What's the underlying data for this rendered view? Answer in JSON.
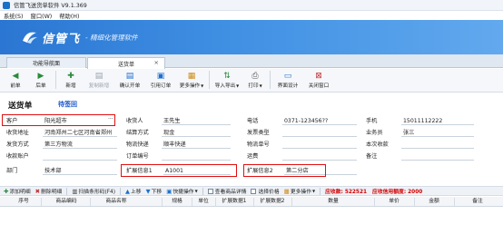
{
  "window": {
    "title": "信管飞送货单软件 V9.1.369"
  },
  "menu": [
    "系统(S)",
    "窗口(W)",
    "帮助(H)"
  ],
  "banner": {
    "brand": "信管飞",
    "slogan": "- 精细化管理软件"
  },
  "tabs": [
    {
      "label": "功能导航面"
    },
    {
      "label": "送货单",
      "close": "×"
    }
  ],
  "toolbar": {
    "items": [
      {
        "label": "前单",
        "icon": "◀"
      },
      {
        "label": "后单",
        "icon": "▶"
      },
      {
        "label": "新增",
        "icon": "✚"
      },
      {
        "label": "复制新增",
        "icon": "▤"
      },
      {
        "label": "确认开单",
        "icon": "▤"
      },
      {
        "label": "引用订单",
        "icon": "▣"
      },
      {
        "label": "更多操作",
        "icon": "▦"
      },
      {
        "label": "导入导出",
        "icon": "⇅"
      },
      {
        "label": "打印",
        "icon": "⎙"
      },
      {
        "label": "界面设计",
        "icon": "▭"
      },
      {
        "label": "关闭窗口",
        "icon": "⊠"
      }
    ]
  },
  "doc": {
    "title": "送货单",
    "status": "待签回"
  },
  "form": {
    "customer_label": "客户",
    "customer": "阳光超市",
    "receiver_label": "收货人",
    "receiver": "王先生",
    "phone_label": "电话",
    "phone": "0371-123456??",
    "mobile_label": "手机",
    "mobile": "15011112222",
    "address_label": "收货地址",
    "address": "河南郑州二七区河南省郑州",
    "settle_label": "结算方式",
    "settle": "现金",
    "invoice_label": "发票类型",
    "invoice": "",
    "salesman_label": "业务员",
    "salesman": "张三",
    "ship_label": "发货方式",
    "ship": "第三方物流",
    "logistics_label": "物流快递",
    "logistics": "顺丰快递",
    "tracking_label": "物流单号",
    "tracking": "",
    "receivable_label": "本次收款",
    "receivable": "",
    "account_label": "收款账户",
    "account": "",
    "order_label": "订单编号",
    "order": "",
    "freight_label": "运费",
    "freight": "",
    "note_label": "备注",
    "note": "",
    "dept_label": "部门",
    "dept": "技术部",
    "ext1_label": "扩展信息1",
    "ext1": "A1001",
    "ext2_label": "扩展信息2",
    "ext2": "第二分店"
  },
  "subtoolbar": {
    "items": [
      {
        "label": "添加明细",
        "icon": "✚"
      },
      {
        "label": "删除明细",
        "icon": "✖"
      },
      {
        "label": "扫描条形码(F4)",
        "icon": "▥"
      },
      {
        "label": "上移",
        "icon": "▲"
      },
      {
        "label": "下移",
        "icon": "▼"
      },
      {
        "label": "快捷操作",
        "icon": "▣"
      },
      {
        "label": "查看商品详情",
        "icon": "▤"
      },
      {
        "label": "选择价格",
        "icon": "▤"
      },
      {
        "label": "更多操作",
        "icon": "▦"
      }
    ],
    "receivable_text": "应收款: 522521",
    "credit_text": "应收信用额度: 2000"
  },
  "grid": {
    "headers": [
      "序号",
      "商品编码",
      "商品名称",
      "规格",
      "单位",
      "扩展数据1",
      "扩展数据2",
      "数量",
      "单价",
      "金额",
      "备注"
    ]
  },
  "colors": {
    "banner": "#2a76d2",
    "highlight": "#e10f0f",
    "status": "#1a56c9"
  }
}
